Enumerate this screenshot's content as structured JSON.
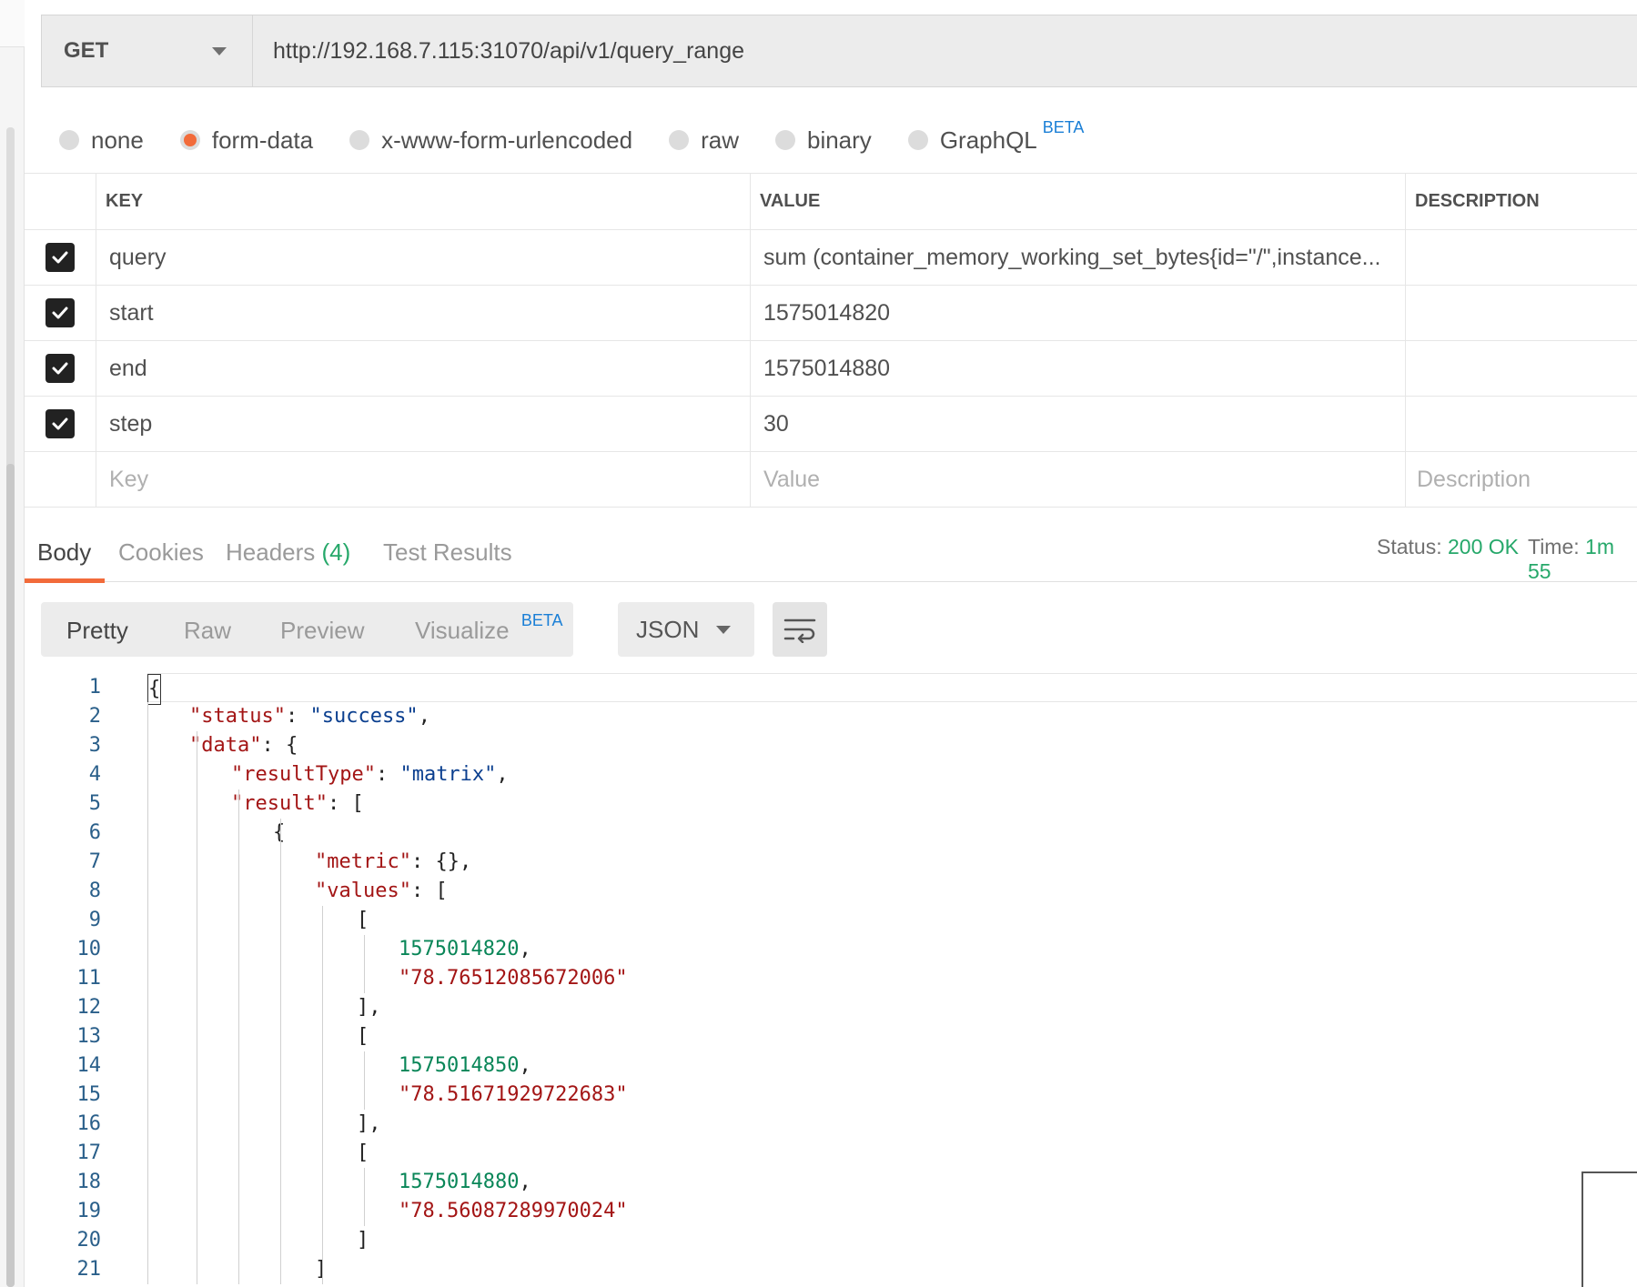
{
  "request": {
    "method": "GET",
    "url": "http://192.168.7.115:31070/api/v1/query_range"
  },
  "body_types": [
    {
      "label": "none",
      "checked": false
    },
    {
      "label": "form-data",
      "checked": true
    },
    {
      "label": "x-www-form-urlencoded",
      "checked": false
    },
    {
      "label": "raw",
      "checked": false
    },
    {
      "label": "binary",
      "checked": false
    },
    {
      "label": "GraphQL",
      "checked": false,
      "badge": "BETA"
    }
  ],
  "params": {
    "headers": {
      "key": "KEY",
      "value": "VALUE",
      "description": "DESCRIPTION"
    },
    "rows": [
      {
        "key": "query",
        "value": "sum (container_memory_working_set_bytes{id=\"/\",instance...",
        "checked": true
      },
      {
        "key": "start",
        "value": "1575014820",
        "checked": true
      },
      {
        "key": "end",
        "value": "1575014880",
        "checked": true
      },
      {
        "key": "step",
        "value": "30",
        "checked": true
      }
    ],
    "placeholders": {
      "key": "Key",
      "value": "Value",
      "description": "Description"
    }
  },
  "response": {
    "tabs": {
      "body": "Body",
      "cookies": "Cookies",
      "headers": "Headers",
      "headers_count": "(4)",
      "test_results": "Test Results"
    },
    "status_label": "Status:",
    "status_value": "200 OK",
    "time_label": "Time:",
    "time_value": "1m 55"
  },
  "view": {
    "pretty": "Pretty",
    "raw": "Raw",
    "preview": "Preview",
    "visualize": "Visualize",
    "visualize_badge": "BETA",
    "format": "JSON"
  },
  "code_lines": [
    "{",
    "\"status\": \"success\",",
    "\"data\": {",
    "\"resultType\": \"matrix\",",
    "\"result\": [",
    "{",
    "\"metric\": {},",
    "\"values\": [",
    "[",
    "1575014820,",
    "\"78.76512085672006\"",
    "],",
    "[",
    "1575014850,",
    "\"78.51671929722683\"",
    "],",
    "[",
    "1575014880,",
    "\"78.56087289970024\"",
    "]",
    "]"
  ],
  "colors": {
    "accent": "#f26b3a",
    "status_green": "#26a86a",
    "beta_blue": "#1a7fd6",
    "json_key": "#a31515",
    "json_string": "#0b3f8f",
    "json_number": "#098658"
  },
  "icons": {
    "method_dropdown": "chevron-down-icon",
    "format_dropdown": "chevron-down-icon",
    "wrap": "wrap-lines-icon",
    "checkbox": "check-icon"
  }
}
